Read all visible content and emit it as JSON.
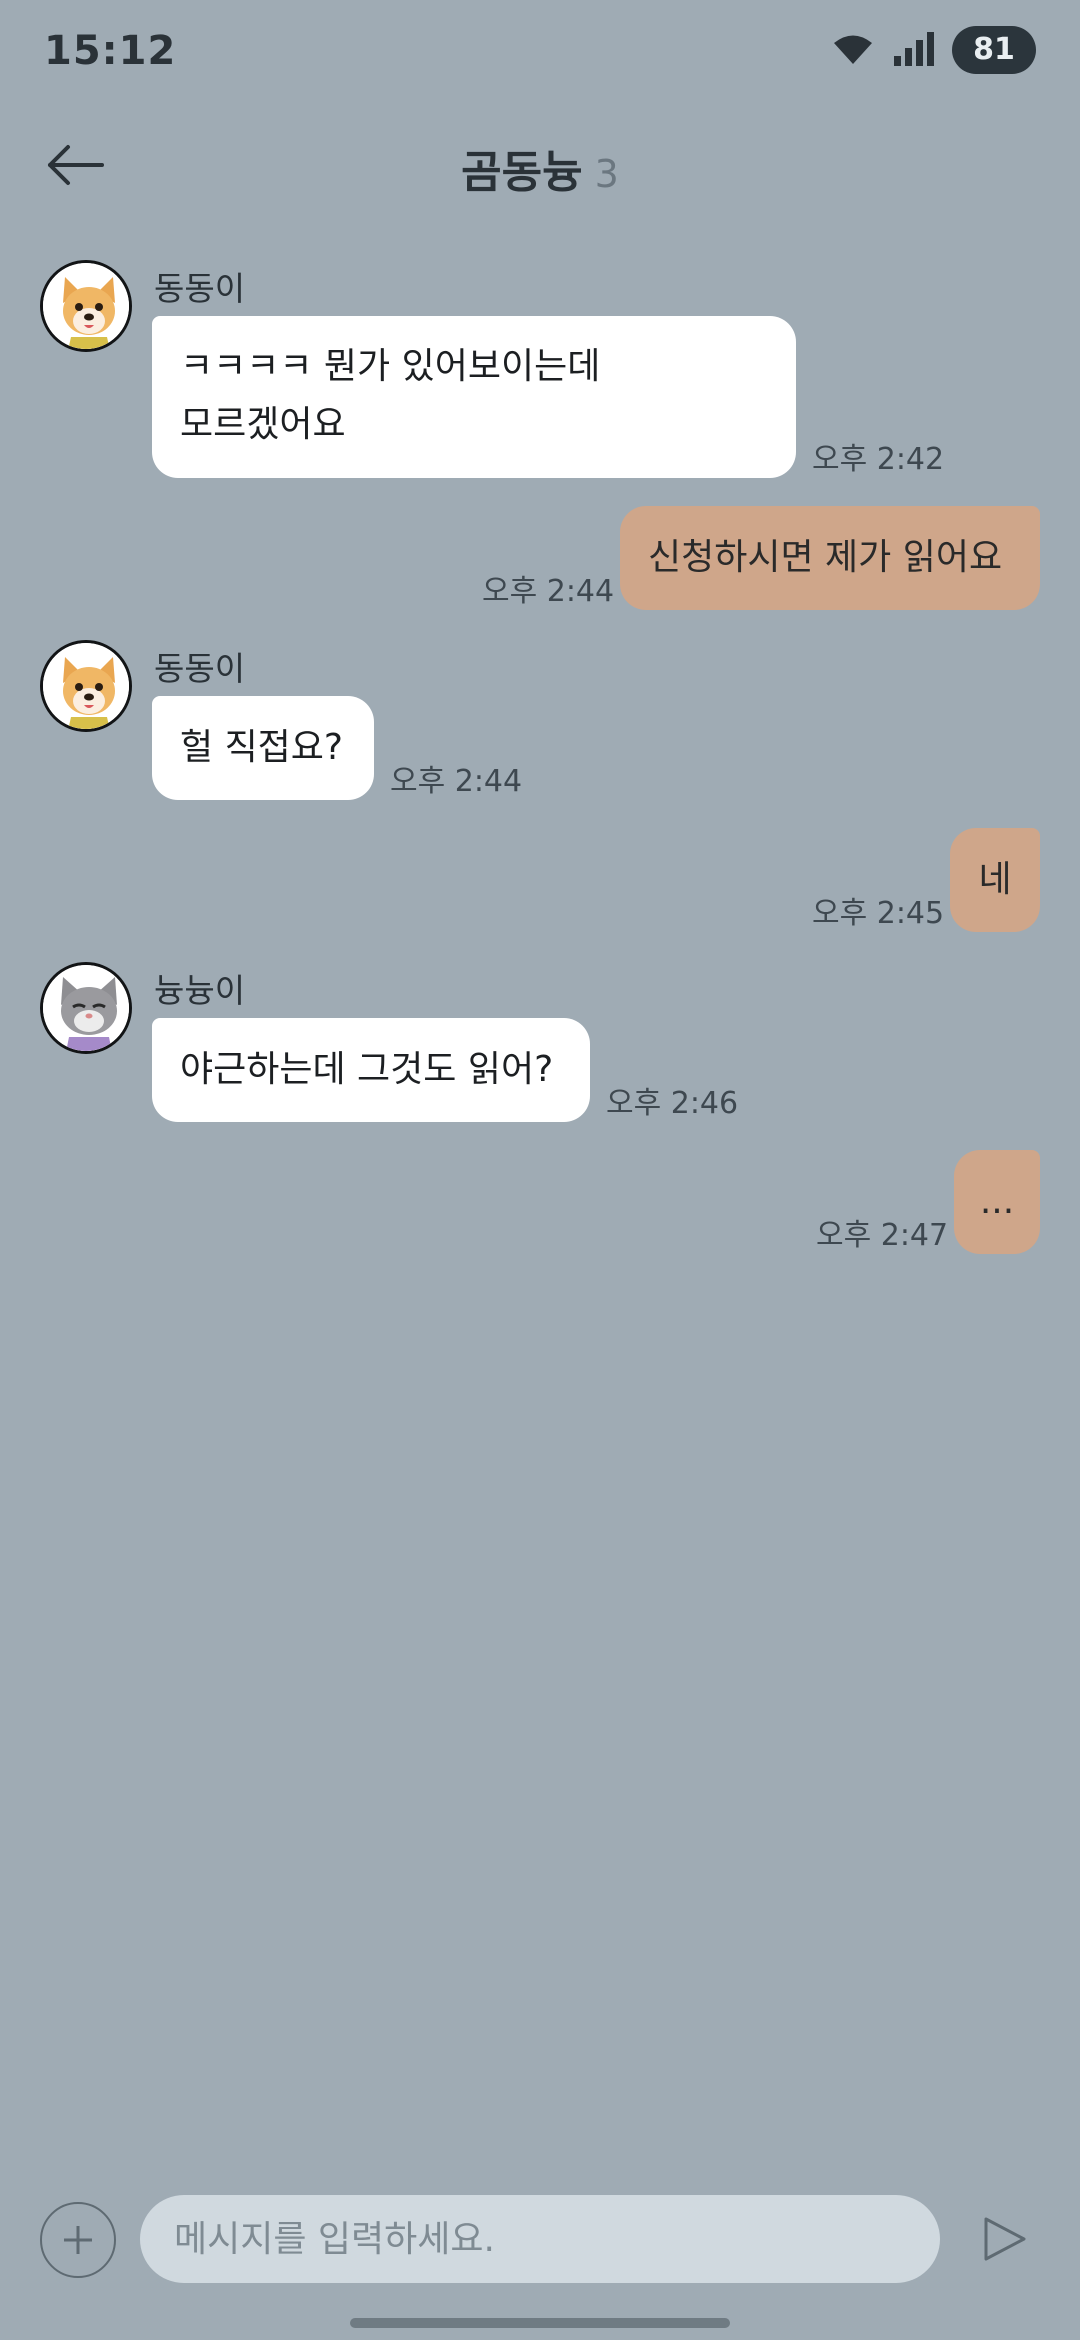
{
  "status_bar": {
    "time": "15:12",
    "battery": "81",
    "icons": [
      "wifi-icon",
      "signal-icon"
    ]
  },
  "header": {
    "title": "곰동늉",
    "member_count": "3",
    "back_icon": "back-arrow-icon"
  },
  "messages": [
    {
      "direction": "in",
      "sender": "동동이",
      "avatar": "dog-avatar",
      "lines": [
        "ㅋㅋㅋㅋ 뭔가 있어보이는데",
        "모르겠어요"
      ],
      "time": "오후 2:42"
    },
    {
      "direction": "out",
      "text": "신청하시면 제가 읽어요",
      "time": "오후 2:44"
    },
    {
      "direction": "in",
      "sender": "동동이",
      "avatar": "dog-avatar",
      "text": "헐 직접요?",
      "time": "오후 2:44"
    },
    {
      "direction": "out",
      "text": "네",
      "time": "오후 2:45"
    },
    {
      "direction": "in",
      "sender": "늉늉이",
      "avatar": "cat-avatar",
      "text": "야근하는데 그것도 읽어?",
      "time": "오후 2:46"
    },
    {
      "direction": "out",
      "text": "...",
      "time": "오후 2:47"
    }
  ],
  "composer": {
    "placeholder": "메시지를 입력하세요.",
    "add_icon": "plus-icon",
    "send_icon": "send-icon"
  },
  "colors": {
    "background": "#9fabb4",
    "incoming_bubble": "#ffffff",
    "outgoing_bubble": "#cfa68a",
    "input_field": "#d0d9df"
  }
}
